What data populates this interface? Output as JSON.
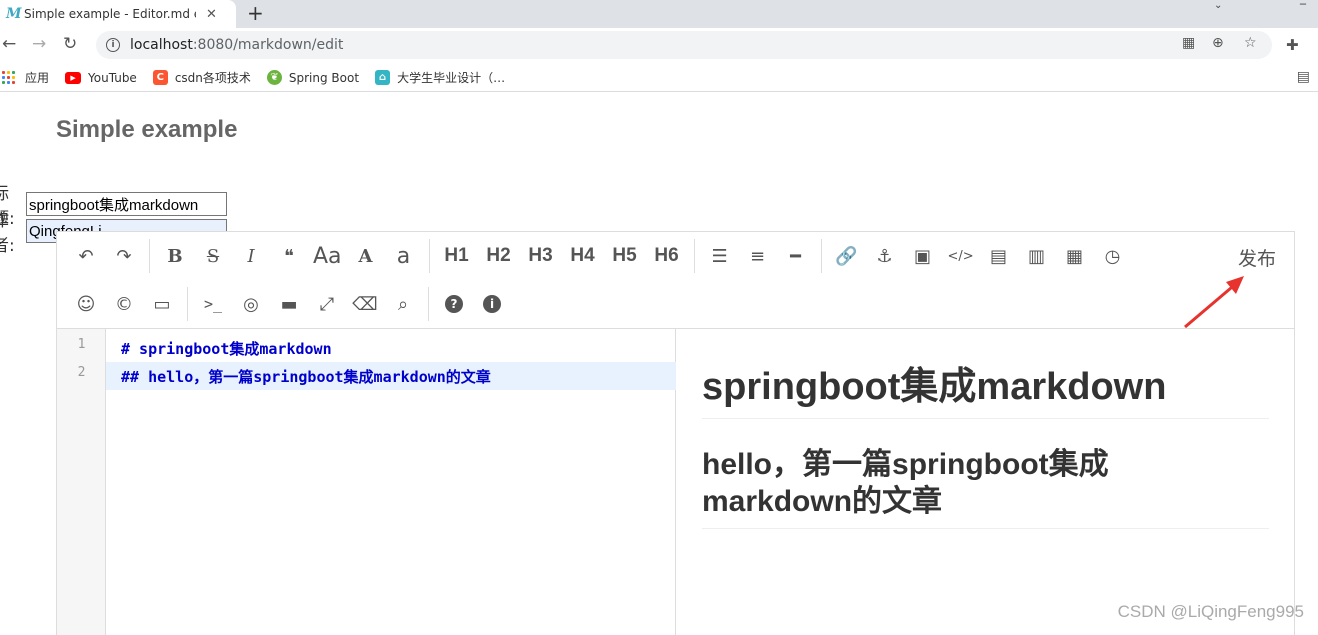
{
  "browser": {
    "tab_title": "Simple example - Editor.md ex",
    "tab_favicon": "M",
    "new_tab_label": "+",
    "url_host": "localhost",
    "url_path": ":8080/markdown/edit",
    "bookmarks": [
      {
        "label": "应用",
        "icon": "apps-grid-icon"
      },
      {
        "label": "YouTube",
        "icon": "youtube-icon",
        "color": "#ff0000"
      },
      {
        "label": "csdn各项技术",
        "icon": "csdn-icon",
        "color": "#fc5531"
      },
      {
        "label": "Spring Boot",
        "icon": "spring-icon",
        "color": "#6db33f"
      },
      {
        "label": "大学生毕业设计（…",
        "icon": "graduation-icon",
        "color": "#33b5c4"
      }
    ]
  },
  "page": {
    "title": "Simple example",
    "title_field": {
      "label": "标题:",
      "value": "springboot集成markdown"
    },
    "author_field": {
      "label": "作者:",
      "value": "QingfengLi"
    }
  },
  "editor": {
    "toolbar_row1": [
      {
        "name": "undo",
        "glyph": "↶"
      },
      {
        "name": "redo",
        "glyph": "↷"
      },
      {
        "sep": true
      },
      {
        "name": "bold",
        "glyph": "B"
      },
      {
        "name": "strikethrough",
        "glyph": "S"
      },
      {
        "name": "italic",
        "glyph": "I"
      },
      {
        "name": "quote",
        "glyph": "❝"
      },
      {
        "name": "uppercase",
        "glyph": "Aa"
      },
      {
        "name": "uppercase-first",
        "glyph": "A"
      },
      {
        "name": "lowercase",
        "glyph": "a"
      },
      {
        "sep": true
      },
      {
        "name": "h1",
        "glyph": "H1",
        "heading": true
      },
      {
        "name": "h2",
        "glyph": "H2",
        "heading": true
      },
      {
        "name": "h3",
        "glyph": "H3",
        "heading": true
      },
      {
        "name": "h4",
        "glyph": "H4",
        "heading": true
      },
      {
        "name": "h5",
        "glyph": "H5",
        "heading": true
      },
      {
        "name": "h6",
        "glyph": "H6",
        "heading": true
      },
      {
        "sep": true
      },
      {
        "name": "unordered-list",
        "glyph": "☰"
      },
      {
        "name": "ordered-list",
        "glyph": "≡"
      },
      {
        "name": "horizontal-rule",
        "glyph": "━"
      },
      {
        "sep": true
      },
      {
        "name": "link",
        "glyph": "🔗"
      },
      {
        "name": "anchor",
        "glyph": "⚓"
      },
      {
        "name": "image",
        "glyph": "▣"
      },
      {
        "name": "inline-code",
        "glyph": "</>"
      },
      {
        "name": "code-block",
        "glyph": "▤"
      },
      {
        "name": "preformatted",
        "glyph": "▥"
      },
      {
        "name": "table",
        "glyph": "▦"
      },
      {
        "name": "datetime",
        "glyph": "◷"
      }
    ],
    "toolbar_row2": [
      {
        "name": "emoji",
        "glyph": "☺"
      },
      {
        "name": "html-entities",
        "glyph": "©"
      },
      {
        "name": "pagebreak",
        "glyph": "▭"
      },
      {
        "sep": true
      },
      {
        "name": "goto-line",
        "glyph": ">_"
      },
      {
        "name": "watch",
        "glyph": "◎"
      },
      {
        "name": "preview",
        "glyph": "▬"
      },
      {
        "name": "fullscreen",
        "glyph": "⤢"
      },
      {
        "name": "clear",
        "glyph": "⌫"
      },
      {
        "name": "search",
        "glyph": "⌕"
      },
      {
        "sep": true
      },
      {
        "name": "help",
        "glyph": "?"
      },
      {
        "name": "info",
        "glyph": "i"
      }
    ],
    "publish_label": "发布",
    "lines": [
      {
        "number": "1",
        "text": "# springboot集成markdown"
      },
      {
        "number": "2",
        "text": "## hello，第一篇springboot集成markdown的文章"
      }
    ],
    "preview": {
      "h1": "springboot集成markdown",
      "h2_line1": "hello，第一篇springboot集成",
      "h2_line2": "markdown的文章"
    }
  },
  "watermark": "CSDN @LiQingFeng995",
  "colors": {
    "accent_arrow": "#e8322e",
    "code_text": "#0000cc",
    "active_line": "#e8f2ff"
  }
}
